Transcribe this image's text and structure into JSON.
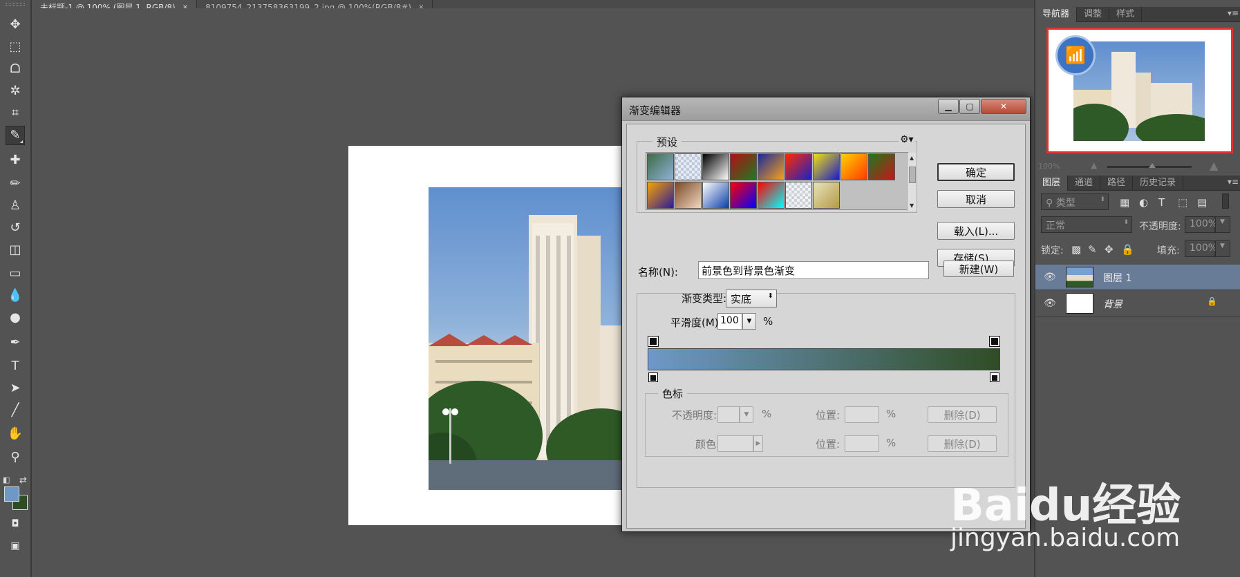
{
  "doc_tabs": [
    {
      "title": "未标题-1 @ 100% (图层 1, RGB/8)",
      "close": "×"
    },
    {
      "title": "8109754_213758363199_2.jpg @ 100%(RGB/8#)",
      "close": "×"
    }
  ],
  "colors": {
    "foreground": "#6f98c7",
    "background": "#2f4d24",
    "selected_layer": "#687b97",
    "nav_proxy": "#dd3333"
  },
  "toolbar": {
    "tools": [
      {
        "icon": "move-icon"
      },
      {
        "icon": "marquee-icon"
      },
      {
        "icon": "lasso-icon"
      },
      {
        "icon": "magic-wand-icon"
      },
      {
        "icon": "crop-icon"
      },
      {
        "icon": "eyedropper-icon"
      },
      {
        "icon": "healing-brush-icon"
      },
      {
        "icon": "brush-icon"
      },
      {
        "icon": "clone-stamp-icon"
      },
      {
        "icon": "history-brush-icon"
      },
      {
        "icon": "eraser-icon"
      },
      {
        "icon": "gradient-icon"
      },
      {
        "icon": "blur-icon"
      },
      {
        "icon": "dodge-icon"
      },
      {
        "icon": "pen-icon"
      },
      {
        "icon": "type-icon",
        "glyph": "T"
      },
      {
        "icon": "path-selection-icon"
      },
      {
        "icon": "line-icon"
      },
      {
        "icon": "hand-icon"
      },
      {
        "icon": "zoom-icon"
      }
    ]
  },
  "dialog": {
    "title": "渐变编辑器",
    "presets_legend": "预设",
    "ok": "确定",
    "cancel": "取消",
    "load": "载入(L)...",
    "save": "存储(S)...",
    "new": "新建(W)",
    "name_label": "名称(N):",
    "name_value": "前景色到背景色渐变",
    "type_label": "渐变类型:",
    "type_value": "实底",
    "smooth_label": "平滑度(M):",
    "smooth_value": "100",
    "percent": "%",
    "stops_legend": "色标",
    "opacity_label": "不透明度:",
    "color_label": "颜色:",
    "location_label": "位置:",
    "delete": "删除(D)",
    "gradient_from": "#6f98c7",
    "gradient_to": "#2f4d24",
    "presets": [
      [
        "#3d6b45",
        "#8fb2da"
      ],
      [
        "checker",
        "#a7c3e6"
      ],
      [
        "#000000",
        "#ffffff"
      ],
      [
        "#b20f12",
        "#1e7a23"
      ],
      [
        "#1a2a9a",
        "#f7a11a"
      ],
      [
        "#ff2a00",
        "#1622c9"
      ],
      [
        "#f0e10f",
        "#1a1acb"
      ],
      [
        "#ffd000",
        "#ff3a00"
      ],
      [
        "#1b7a19",
        "#c8151c"
      ],
      [
        "#f6a300",
        "#2d1b9a"
      ],
      [
        "#7a4a2a",
        "#f0d6bf"
      ],
      [
        "#ffffff",
        "#0b3ea8"
      ],
      [
        "#ff0000",
        "#0000ff"
      ],
      [
        "#ff0000",
        "#00ffff"
      ],
      [
        "checker",
        "#cfd8e6"
      ],
      [
        "#e9e2bd",
        "#b49a46"
      ]
    ]
  },
  "panels": {
    "top_tabs": [
      "导航器",
      "调整",
      "样式"
    ],
    "nav_zoom": "100%",
    "layer_tabs": [
      "图层",
      "通道",
      "路径",
      "历史记录"
    ],
    "filter_label": "类型",
    "blend_mode": "正常",
    "opacity_label": "不透明度:",
    "opacity_value": "100%",
    "lock_label": "锁定:",
    "fill_label": "填充:",
    "fill_value": "100%",
    "layers": [
      {
        "name": "图层 1",
        "selected": true
      },
      {
        "name": "背景",
        "selected": false,
        "locked": true
      }
    ]
  },
  "watermark": {
    "logo": "Baidu经验",
    "url": "jingyan.baidu.com"
  }
}
